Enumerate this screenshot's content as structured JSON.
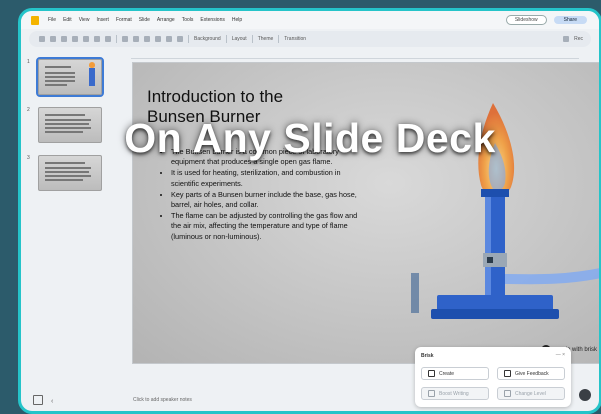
{
  "menubar": {
    "items": [
      "File",
      "Edit",
      "View",
      "Insert",
      "Format",
      "Slide",
      "Arrange",
      "Tools",
      "Extensions",
      "Help"
    ],
    "slideshow_label": "Slideshow",
    "share_label": "Share"
  },
  "toolbar": {
    "background_label": "Background",
    "layout_label": "Layout",
    "theme_label": "Theme",
    "transition_label": "Transition",
    "mode_label": "Rec"
  },
  "filmstrip": {
    "slides": [
      {
        "number": "1",
        "selected": true
      },
      {
        "number": "2",
        "selected": false
      },
      {
        "number": "3",
        "selected": false
      }
    ]
  },
  "slide": {
    "title": "Introduction to the Bunsen Burner",
    "bullets": [
      "The Bunsen burner is a common piece of laboratory equipment that produces a single open gas flame.",
      "It is used for heating, sterilization, and combustion in scientific experiments.",
      "Key parts of a Bunsen burner include the base, gas hose, barrel, air holes, and collar.",
      "The flame can be adjusted by controlling the gas flow and the air mix, affecting the temperature and type of flame (luminous or non-luminous)."
    ],
    "watermark": "made with brisk"
  },
  "overlay": {
    "caption": "On Any Slide Deck"
  },
  "speaker_notes": {
    "placeholder": "Click to add speaker notes"
  },
  "brisk_panel": {
    "title": "Brisk",
    "controls": "— ×",
    "buttons": [
      {
        "label": "Create",
        "enabled": true
      },
      {
        "label": "Give Feedback",
        "enabled": true
      },
      {
        "label": "Boost Writing",
        "enabled": false
      },
      {
        "label": "Change Level",
        "enabled": false
      }
    ]
  },
  "colors": {
    "frame_border": "#25c4c9",
    "page_background": "#2c5b6b",
    "flame": "#f39c3a",
    "burner_blue": "#2f62c9"
  }
}
